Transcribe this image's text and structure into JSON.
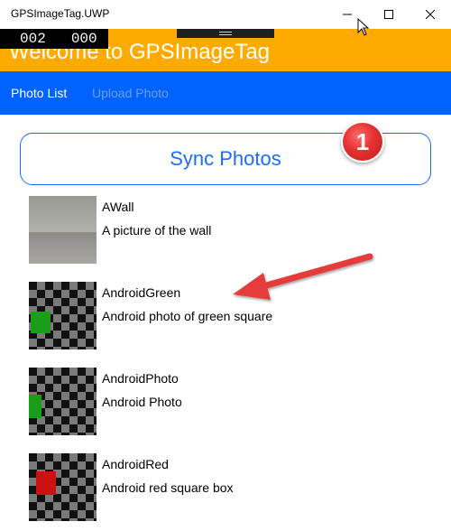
{
  "window": {
    "title": "GPSImageTag.UWP"
  },
  "header": {
    "title": "Welcome to GPSImageTag"
  },
  "frame_counter": {
    "left": "002",
    "right": "000"
  },
  "nav": {
    "tabs": [
      {
        "label": "Photo List",
        "active": true
      },
      {
        "label": "Upload Photo",
        "active": false
      }
    ]
  },
  "sync": {
    "label": "Sync Photos"
  },
  "callout": {
    "number": "1"
  },
  "photos": [
    {
      "name": "AWall",
      "description": "A picture of the wall",
      "thumb": "wall"
    },
    {
      "name": "AndroidGreen",
      "description": "Android photo of green square",
      "thumb": "checker-green"
    },
    {
      "name": "AndroidPhoto",
      "description": "Android Photo",
      "thumb": "checker-green"
    },
    {
      "name": "AndroidRed",
      "description": "Android red square box",
      "thumb": "checker-red"
    }
  ],
  "colors": {
    "header": "#ffaa00",
    "nav": "#0063ff",
    "accent": "#1a6dff",
    "callout": "#e53030",
    "green": "#1a9e1a",
    "red": "#cc1111"
  }
}
